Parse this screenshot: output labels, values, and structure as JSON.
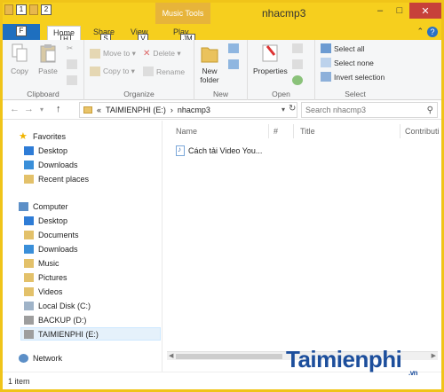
{
  "titlebar": {
    "title": "nhacmp3",
    "context_label": "Music Tools",
    "qat_keytips": [
      "1",
      "2"
    ]
  },
  "tabs": {
    "file": {
      "keytip": "F"
    },
    "items": [
      {
        "label": "Home",
        "keytip": "H"
      },
      {
        "label": "Share",
        "keytip": "S"
      },
      {
        "label": "View",
        "keytip": "V"
      },
      {
        "label": "Play",
        "keytip": "JM"
      }
    ]
  },
  "ribbon": {
    "clipboard": {
      "label": "Clipboard",
      "copy": "Copy",
      "paste": "Paste"
    },
    "organize": {
      "label": "Organize",
      "move_to": "Move to ▾",
      "copy_to": "Copy to ▾",
      "delete": "Delete ▾",
      "rename": "Rename"
    },
    "new": {
      "label": "New",
      "new_folder": "New\nfolder"
    },
    "open": {
      "label": "Open",
      "properties": "Properties"
    },
    "select": {
      "label": "Select",
      "select_all": "Select all",
      "select_none": "Select none",
      "invert": "Invert selection"
    }
  },
  "address": {
    "prefix": "«",
    "drive": "TAIMIENPHI (E:)",
    "separator": "›",
    "folder": "nhacmp3",
    "search_placeholder": "Search nhacmp3"
  },
  "navpane": {
    "favorites": "Favorites",
    "fav_items": [
      "Desktop",
      "Downloads",
      "Recent places"
    ],
    "computer": "Computer",
    "comp_items": [
      "Desktop",
      "Documents",
      "Downloads",
      "Music",
      "Pictures",
      "Videos",
      "Local Disk (C:)",
      "BACKUP (D:)",
      "TAIMIENPHI (E:)"
    ],
    "network": "Network"
  },
  "content": {
    "columns": [
      "Name",
      "#",
      "Title",
      "Contributi"
    ],
    "files": [
      {
        "name": "Cách tải Video You..."
      }
    ]
  },
  "status": {
    "count": "1 item"
  },
  "watermark": {
    "brand": "Taimienphi",
    "suffix": ".vn"
  },
  "colors": {
    "accent": "#f6cf1e",
    "file_tab": "#1e6fbf",
    "close": "#c7413a",
    "brand": "#1c4e9c"
  }
}
